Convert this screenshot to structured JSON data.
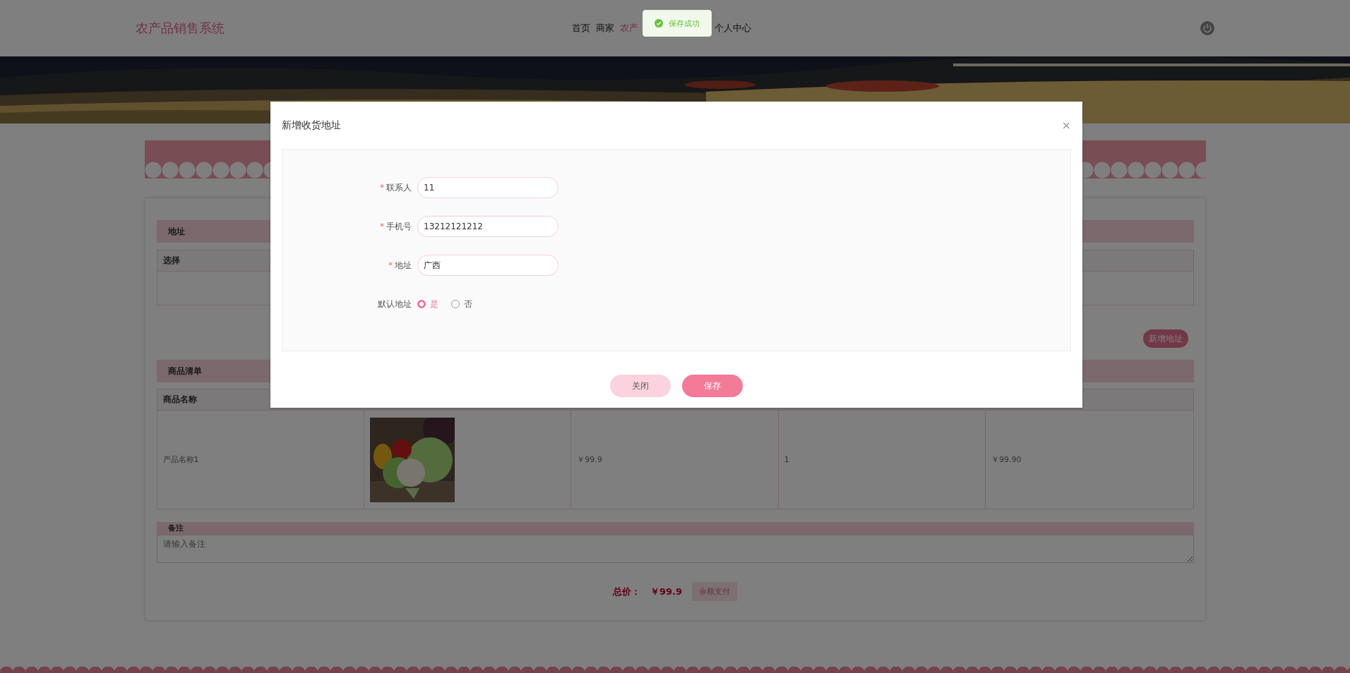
{
  "header": {
    "logo": "农产品销售系统",
    "nav": [
      {
        "label": "首页",
        "selected": false
      },
      {
        "label": "商家",
        "selected": false
      },
      {
        "label": "农产",
        "selected": true
      },
      {
        "label": "个人中心",
        "selected": false
      }
    ]
  },
  "toast": {
    "message": "保存成功"
  },
  "address_section": {
    "title": "地址",
    "columns": [
      "选择"
    ],
    "add_button": "新增地址"
  },
  "goods_section": {
    "title": "商品清单",
    "columns": [
      "商品名称"
    ],
    "rows": [
      {
        "name": "产品名称1",
        "price": "￥99.9",
        "quantity": "1",
        "subtotal": "￥99.90"
      }
    ]
  },
  "remark": {
    "title": "备注",
    "placeholder": "请输入备注"
  },
  "total": {
    "label": "总价：",
    "amount": "￥99.9",
    "pay_button": "余额支付"
  },
  "dialog": {
    "title": "新增收货地址",
    "close": "×",
    "fields": [
      {
        "label": "联系人",
        "required_mark": "*",
        "value": "11"
      },
      {
        "label": "手机号",
        "required_mark": "*",
        "value": "13212121212"
      },
      {
        "label": "地址",
        "required_mark": "*",
        "value": "广西"
      }
    ],
    "default_address": {
      "label": "默认地址",
      "options": [
        {
          "label": "是",
          "selected": true
        },
        {
          "label": "否",
          "selected": false
        }
      ]
    },
    "buttons": [
      {
        "label": "关闭",
        "kind": "secondary"
      },
      {
        "label": "保存",
        "kind": "primary"
      }
    ]
  }
}
